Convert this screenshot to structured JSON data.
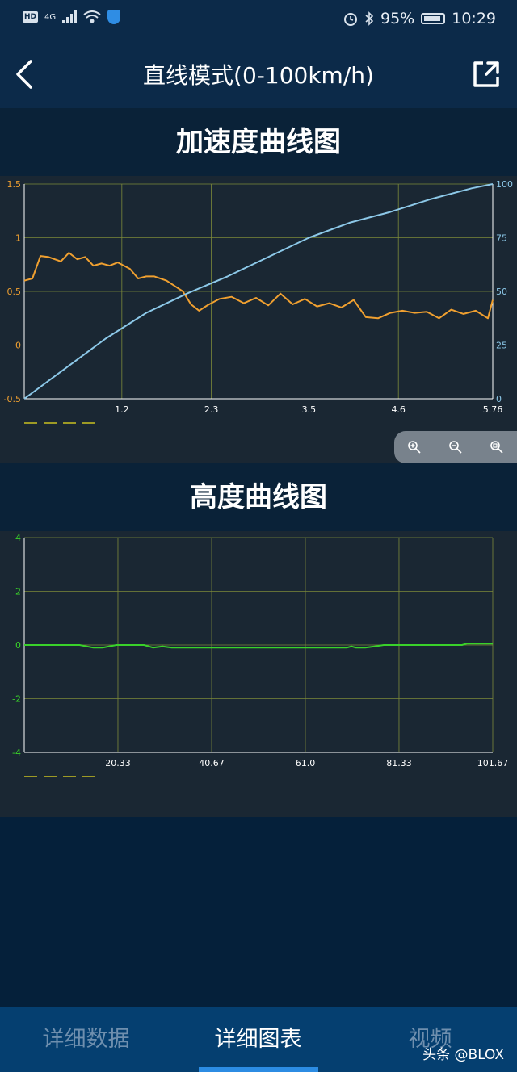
{
  "status": {
    "hd": "HD",
    "network": "4G",
    "battery_pct": "95%",
    "time": "10:29"
  },
  "nav": {
    "title": "直线模式(0-100km/h)"
  },
  "accel_section": {
    "title": "加速度曲线图"
  },
  "height_section": {
    "title": "高度曲线图"
  },
  "chart_data": [
    {
      "type": "line",
      "x_ticks": [
        "1.2",
        "2.3",
        "3.5",
        "4.6",
        "5.76"
      ],
      "y_left_ticks": [
        "1.5",
        "1",
        "0.5",
        "0",
        "-0.5"
      ],
      "y_right_ticks": [
        "100",
        "75",
        "50",
        "25",
        "0"
      ],
      "xlim": [
        0,
        5.76
      ],
      "ylim_left": [
        -0.5,
        1.5
      ],
      "ylim_right": [
        0,
        100
      ],
      "grid": true,
      "series": [
        {
          "color": "#f0a030",
          "axis": "left",
          "x": [
            0,
            0.1,
            0.2,
            0.3,
            0.45,
            0.55,
            0.65,
            0.75,
            0.85,
            0.95,
            1.05,
            1.15,
            1.3,
            1.4,
            1.5,
            1.6,
            1.75,
            1.85,
            1.95,
            2.05,
            2.15,
            2.25,
            2.4,
            2.55,
            2.7,
            2.85,
            3.0,
            3.15,
            3.3,
            3.45,
            3.6,
            3.75,
            3.9,
            4.05,
            4.2,
            4.35,
            4.5,
            4.65,
            4.8,
            4.95,
            5.1,
            5.25,
            5.4,
            5.55,
            5.7,
            5.76
          ],
          "y": [
            0.6,
            0.62,
            0.83,
            0.82,
            0.78,
            0.86,
            0.8,
            0.82,
            0.74,
            0.76,
            0.74,
            0.77,
            0.71,
            0.62,
            0.64,
            0.64,
            0.6,
            0.55,
            0.5,
            0.38,
            0.32,
            0.37,
            0.43,
            0.45,
            0.39,
            0.44,
            0.37,
            0.48,
            0.38,
            0.43,
            0.36,
            0.39,
            0.35,
            0.42,
            0.26,
            0.25,
            0.3,
            0.32,
            0.3,
            0.31,
            0.25,
            0.33,
            0.29,
            0.32,
            0.25,
            0.42
          ]
        },
        {
          "color": "#8cc8e8",
          "axis": "right",
          "x": [
            0,
            0.5,
            1.0,
            1.5,
            2.0,
            2.5,
            3.0,
            3.5,
            4.0,
            4.5,
            5.0,
            5.5,
            5.76
          ],
          "y": [
            0,
            14,
            28,
            40,
            49,
            57,
            66,
            75,
            82,
            87,
            93,
            98,
            100
          ]
        }
      ],
      "legend": [
        "—",
        "—",
        "—",
        "—"
      ]
    },
    {
      "type": "line",
      "x_ticks": [
        "20.33",
        "40.67",
        "61.0",
        "81.33",
        "101.67"
      ],
      "y_ticks": [
        "4",
        "2",
        "0",
        "-2",
        "-4"
      ],
      "xlim": [
        0,
        101.67
      ],
      "ylim": [
        -4,
        4
      ],
      "grid": true,
      "series": [
        {
          "color": "#39d12a",
          "x": [
            0,
            12,
            15,
            17,
            20,
            26,
            28,
            30,
            32,
            35,
            40,
            55,
            70,
            71,
            72,
            74,
            76,
            78,
            90,
            95,
            96,
            101.67
          ],
          "y": [
            0,
            0,
            -0.1,
            -0.1,
            0,
            0,
            -0.1,
            -0.05,
            -0.1,
            -0.1,
            -0.1,
            -0.1,
            -0.1,
            -0.05,
            -0.1,
            -0.1,
            -0.05,
            0,
            0,
            0,
            0.05,
            0.05
          ]
        }
      ],
      "legend": [
        "—",
        "—",
        "—",
        "—"
      ]
    }
  ],
  "zoom": {
    "zoom_in_icon": "zoom-in-icon",
    "zoom_out_icon": "zoom-out-icon",
    "zoom_reset_icon": "zoom-reset-icon"
  },
  "tabs": {
    "tab1": "详细数据",
    "tab2": "详细图表",
    "tab3": "视频"
  },
  "watermark": "头条 @BLOX"
}
